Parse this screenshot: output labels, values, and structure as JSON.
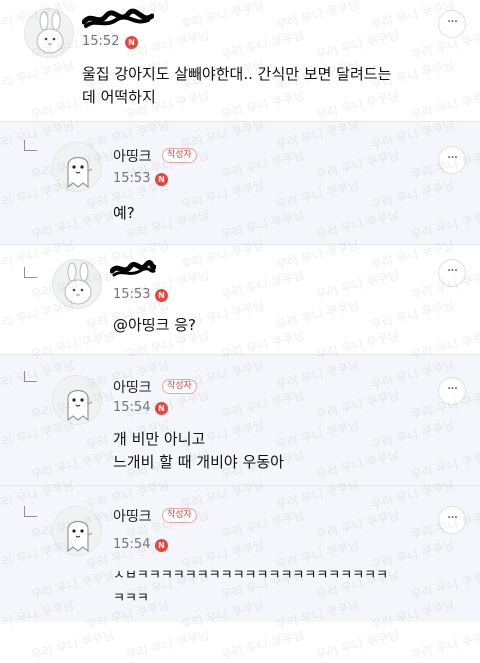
{
  "comments": [
    {
      "nickname": "",
      "nickname_redacted": true,
      "author_badge": "",
      "time": "15:52",
      "n_badge": "N",
      "more": "···",
      "lines": [
        "울집 강아지도 살빼야한대.. 간식만 보면 달려드는",
        "데 어떡하지"
      ],
      "avatar_icon": "rabbit-avatar-icon"
    },
    {
      "nickname": "아띵크",
      "author_badge": "작성자",
      "time": "15:53",
      "n_badge": "N",
      "more": "···",
      "lines": [
        "예?"
      ],
      "avatar_icon": "ghost-avatar-icon"
    },
    {
      "nickname": "",
      "nickname_redacted": true,
      "author_badge": "",
      "time": "15:53",
      "n_badge": "N",
      "more": "···",
      "mention": "@아띵크",
      "lines": [
        "응?"
      ],
      "avatar_icon": "rabbit-avatar-icon"
    },
    {
      "nickname": "아띵크",
      "author_badge": "작성자",
      "time": "15:54",
      "n_badge": "N",
      "more": "···",
      "lines": [
        "개 비만 아니고",
        "느개비 할 때 개비야 우동아"
      ],
      "avatar_icon": "ghost-avatar-icon"
    },
    {
      "nickname": "아띵크",
      "author_badge": "작성자",
      "time": "15:54",
      "n_badge": "N",
      "more": "···",
      "lines": [
        "ㅅㅂㅋㅋㅋㅋㅋㅋㅋㅋㅋㅋㅋㅋㅋㅋㅋㅋㅋㅋㅋㅋㅋ",
        "ㅋㅋㅋ"
      ],
      "avatar_icon": "ghost-avatar-icon"
    }
  ],
  "watermark_text": "우리 우니 쿠쿠님",
  "colors": {
    "reply_bg": "#f4f6fb",
    "n_badge": "#e8463f",
    "author_badge": "#d94a4a"
  }
}
